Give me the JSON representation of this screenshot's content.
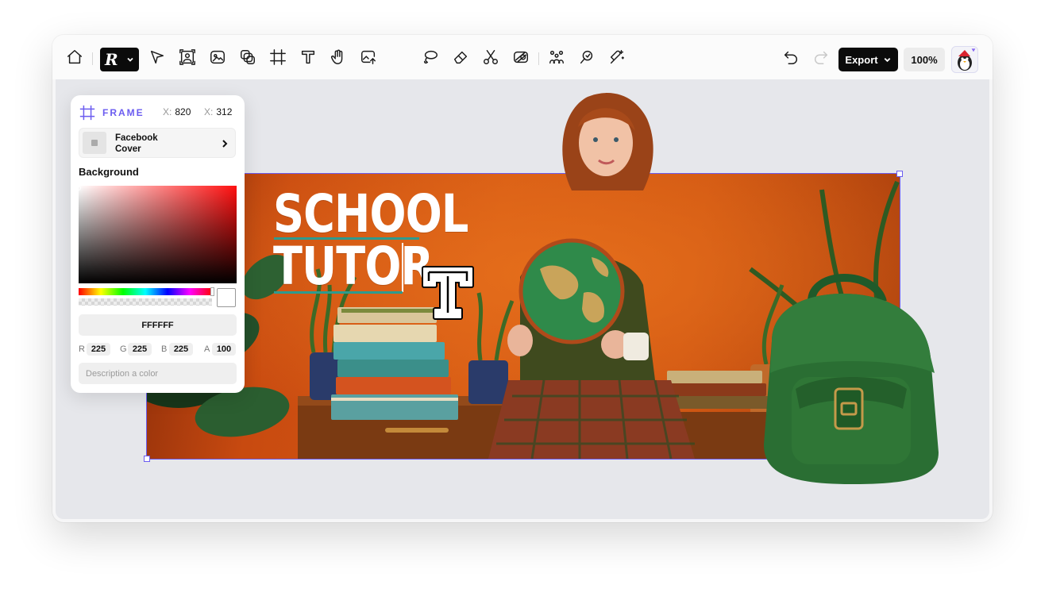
{
  "toolbar": {
    "left_tools": [
      "home-icon",
      "brand-menu",
      "select-arrow-icon",
      "image-frame-icon",
      "image-edit-icon",
      "layers-icon",
      "crop-frame-icon",
      "text-tool-icon",
      "hand-icon",
      "upload-image-icon"
    ],
    "center_tools": [
      "lasso-icon",
      "eraser-icon",
      "scissors-icon",
      "remove-background-icon",
      "group-icon",
      "magic-brush-icon",
      "magic-fill-icon"
    ],
    "export_label": "Export",
    "zoom": "100%"
  },
  "canvas": {
    "headline_line1": "SCHOOL",
    "headline_line2": "TUTOR",
    "accent_color": "#6b5cf0",
    "underline_color": "#2e9b8e"
  },
  "panel": {
    "frame_label": "FRAME",
    "x_label": "X:",
    "x_value": "820",
    "y_label": "X:",
    "y_value": "312",
    "preset_name": "Facebook Cover",
    "background_title": "Background",
    "hex": "FFFFFF",
    "r_label": "R",
    "r": "225",
    "g_label": "G",
    "g": "225",
    "b_label": "B",
    "b": "225",
    "a_label": "A",
    "a": "100",
    "description_placeholder": "Description a color"
  }
}
